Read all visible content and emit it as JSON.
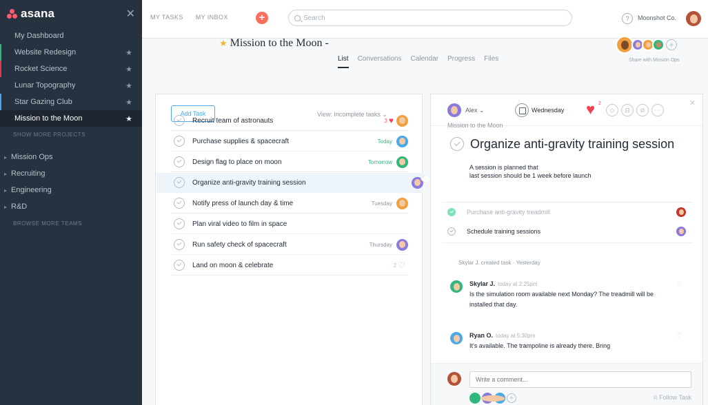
{
  "app": {
    "logo": "asana",
    "close_glyph": "✕"
  },
  "sidebar": {
    "dashboard": "My Dashboard",
    "projects": [
      {
        "label": "Website Redesign",
        "color": "#30b87c"
      },
      {
        "label": "Rocket Science",
        "color": "#e8384f"
      },
      {
        "label": "Lunar Topography",
        "color": ""
      },
      {
        "label": "Star Gazing Club",
        "color": "#4aa9e9"
      },
      {
        "label": "Mission to the Moon",
        "color": "",
        "active": true
      }
    ],
    "show_more": "SHOW MORE PROJECTS",
    "teams": [
      "Mission Ops",
      "Recruiting",
      "Engineering",
      "R&D"
    ],
    "browse": "BROWSE MORE TEAMS"
  },
  "topbar": {
    "my_tasks": "MY TASKS",
    "my_inbox": "MY INBOX",
    "add_glyph": "+",
    "search_placeholder": "Search",
    "help_glyph": "?",
    "user_name": "Moonshot Co."
  },
  "project": {
    "title": "Mission to the Moon",
    "title_suffix": "-",
    "tabs": [
      "List",
      "Conversations",
      "Calendar",
      "Progress",
      "Files"
    ],
    "members_label": "Share with Mission Ops",
    "plus_glyph": "+"
  },
  "list": {
    "add_task": "Add Task",
    "view": "View: Incomplete tasks ⌄",
    "tasks": [
      {
        "name": "Recruit team of astronauts",
        "likes": "3",
        "due": "",
        "avatar": "#f2a03d"
      },
      {
        "name": "Purchase supplies & spacecraft",
        "due": "Today",
        "due_green": true,
        "avatar": "#4aa9e9"
      },
      {
        "name": "Design flag to place on moon",
        "due": "Tomorrow",
        "due_green": true,
        "avatar": "#30b87c"
      },
      {
        "name": "Organize anti-gravity training session",
        "due": "",
        "avatar": "#8a7bdc",
        "selected": true
      },
      {
        "name": "Notify press of launch day & time",
        "due": "Tuesday",
        "avatar": "#f2a03d"
      },
      {
        "name": "Plan viral video to film in space",
        "due": "",
        "avatar": ""
      },
      {
        "name": "Run safety check of spacecraft",
        "due": "Thursday",
        "avatar": "#8a7bdc"
      },
      {
        "name": "Land on moon & celebrate",
        "likes": "2",
        "likes_grey": true,
        "due": "",
        "avatar": ""
      }
    ]
  },
  "detail": {
    "assignee": "Alex ⌄",
    "due": "Wednesday",
    "heart_count": "2",
    "icons": [
      "tag-icon",
      "subtask-icon",
      "attach-icon",
      "more-icon"
    ],
    "icon_glyphs": [
      "◇",
      "⊟",
      "⊘",
      "⋯"
    ],
    "close_glyph": "✕",
    "breadcrumb": "Mission to the Moon",
    "title": "Organize anti-gravity training session",
    "desc_line1": "A session is planned that",
    "desc_line2": "last session should be 1 week before launch",
    "subtasks": [
      {
        "text": "Purchase anti-gravity treadmill",
        "done": true,
        "avatar": "#c0392b"
      },
      {
        "text": "Schedule training sessions",
        "done": false,
        "avatar": "#8a7bdc"
      }
    ],
    "story": "Skylar J. created task · Yesterday",
    "comments": [
      {
        "author": "Skylar J.",
        "time": "today at 2:25pm",
        "body": "Is the simulation room available next Monday? The treadmill will be installed that day.",
        "avatar": "#30b87c"
      },
      {
        "author": "Ryan O.",
        "time": "today at 5:30pm",
        "body": "It's available. The trampoline is already there. Bring",
        "avatar": "#4aa9e9"
      }
    ],
    "comment_placeholder": "Write a comment...",
    "follow": "Follow Task",
    "like_glyph": "♡",
    "plus_glyph": "+"
  }
}
